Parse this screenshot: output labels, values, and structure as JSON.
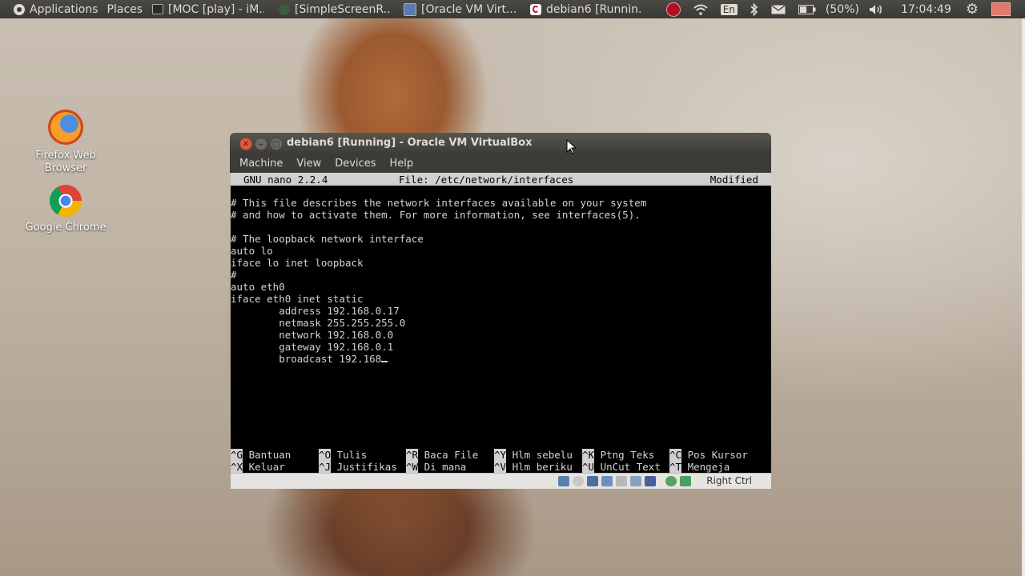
{
  "panel": {
    "applications": "Applications",
    "places": "Places",
    "tasks": [
      {
        "label": "[MOC [play] - iM...",
        "icon": "terminal-icon"
      },
      {
        "label": "[SimpleScreenR...",
        "icon": "recorder-icon"
      },
      {
        "label": "[Oracle VM Virt...",
        "icon": "virtualbox-icon"
      },
      {
        "label": "debian6 [Runnin...",
        "icon": "debian-icon"
      }
    ],
    "keyboard": "En",
    "battery": "(50%)",
    "clock": "17:04:49"
  },
  "desktop": {
    "icons": [
      {
        "label": "Firefox Web Browser"
      },
      {
        "label": "Google Chrome"
      }
    ]
  },
  "window": {
    "title": "debian6 [Running] - Oracle VM VirtualBox",
    "menu": [
      "Machine",
      "View",
      "Devices",
      "Help"
    ],
    "host_key": "Right Ctrl"
  },
  "nano": {
    "version": "GNU nano 2.2.4",
    "file": "File: /etc/network/interfaces",
    "state": "Modified",
    "lines": [
      "# This file describes the network interfaces available on your system",
      "# and how to activate them. For more information, see interfaces(5).",
      "",
      "# The loopback network interface",
      "auto lo",
      "iface lo inet loopback",
      "#",
      "auto eth0",
      "iface eth0 inet static",
      "        address 192.168.0.17",
      "        netmask 255.255.255.0",
      "        network 192.168.0.0",
      "        gateway 192.168.0.1",
      "        broadcast 192.168"
    ],
    "shortcuts_row1": [
      {
        "key": "^G",
        "label": "Bantuan"
      },
      {
        "key": "^O",
        "label": "Tulis"
      },
      {
        "key": "^R",
        "label": "Baca File"
      },
      {
        "key": "^Y",
        "label": "Hlm sebelu"
      },
      {
        "key": "^K",
        "label": "Ptng Teks"
      },
      {
        "key": "^C",
        "label": "Pos Kursor"
      }
    ],
    "shortcuts_row2": [
      {
        "key": "^X",
        "label": "Keluar"
      },
      {
        "key": "^J",
        "label": "Justifikas"
      },
      {
        "key": "^W",
        "label": "Di mana"
      },
      {
        "key": "^V",
        "label": "Hlm beriku"
      },
      {
        "key": "^U",
        "label": "UnCut Text"
      },
      {
        "key": "^T",
        "label": "Mengeja"
      }
    ]
  }
}
